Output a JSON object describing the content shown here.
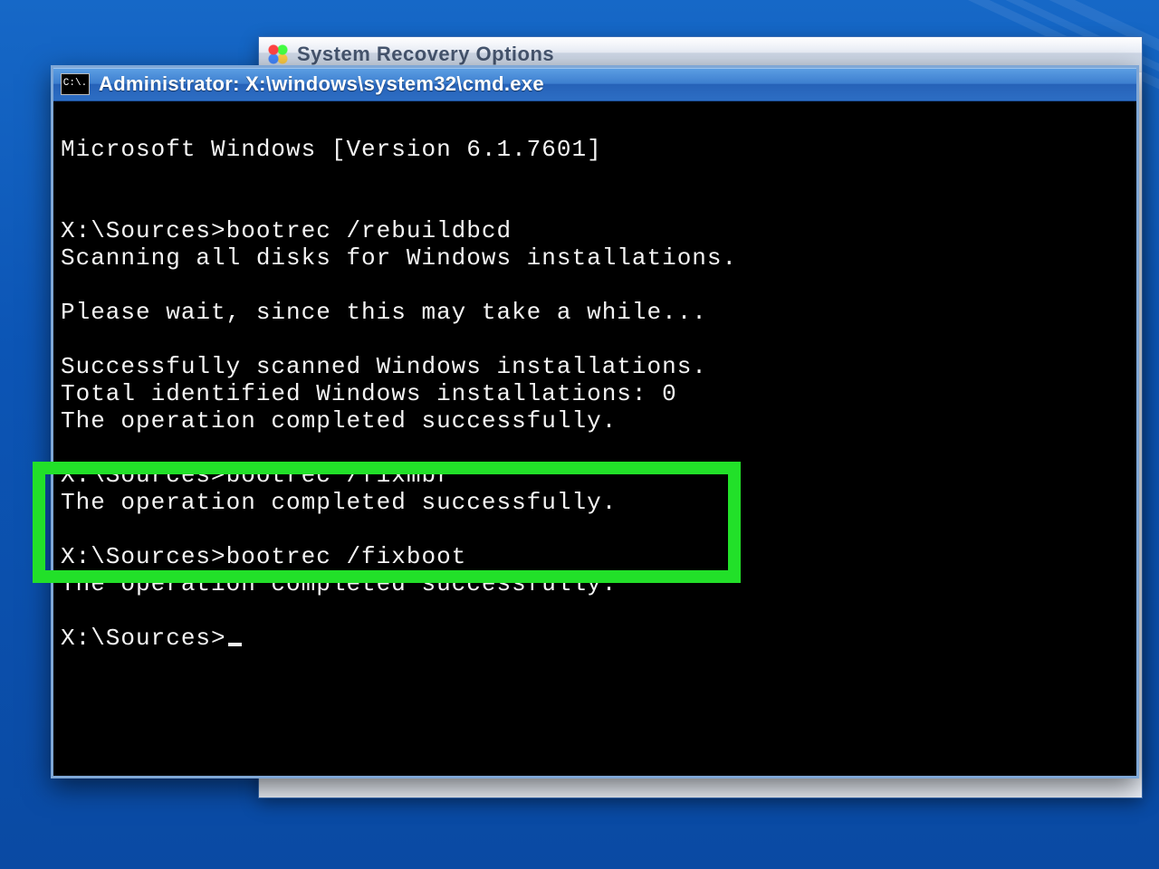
{
  "bg_window": {
    "title": "System Recovery Options"
  },
  "cmd": {
    "icon_label": "C:\\.",
    "title": "Administrator: X:\\windows\\system32\\cmd.exe",
    "lines": {
      "l0": "Microsoft Windows [Version 6.1.7601]",
      "l1": "",
      "l2": "",
      "l3": "X:\\Sources>bootrec /rebuildbcd",
      "l4": "Scanning all disks for Windows installations.",
      "l5": "",
      "l6": "Please wait, since this may take a while...",
      "l7": "",
      "l8": "Successfully scanned Windows installations.",
      "l9": "Total identified Windows installations: 0",
      "l10": "The operation completed successfully.",
      "l11": "",
      "l12": "X:\\Sources>bootrec /fixmbr",
      "l13": "The operation completed successfully.",
      "l14": "",
      "l15": "X:\\Sources>bootrec /fixboot",
      "l16": "The operation completed successfully.",
      "l17": "",
      "l18": "X:\\Sources>"
    }
  }
}
